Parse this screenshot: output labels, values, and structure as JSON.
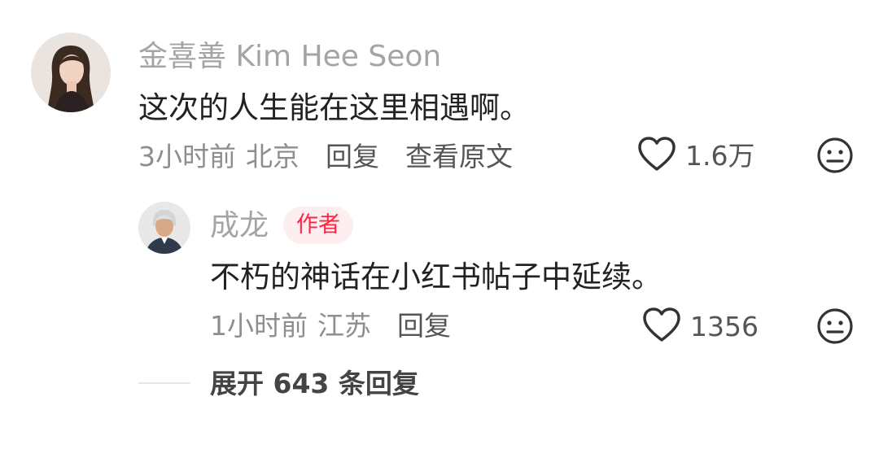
{
  "comment": {
    "author": "金喜善 Kim Hee Seon",
    "text": "这次的人生能在这里相遇啊。",
    "time": "3小时前",
    "location": "北京",
    "reply_label": "回复",
    "view_original_label": "查看原文",
    "likes": "1.6万"
  },
  "reply": {
    "author": "成龙",
    "author_badge": "作者",
    "text": "不朽的神话在小红书帖子中延续。",
    "time": "1小时前",
    "location": "江苏",
    "reply_label": "回复",
    "likes": "1356"
  },
  "expand_replies": "展开 643 条回复",
  "colors": {
    "accent": "#ff2442",
    "badge_bg": "#fdeef0",
    "text": "#222222",
    "muted": "#8e8e8e"
  },
  "icons": {
    "like": "heart-outline-icon",
    "reaction": "neutral-face-icon"
  }
}
